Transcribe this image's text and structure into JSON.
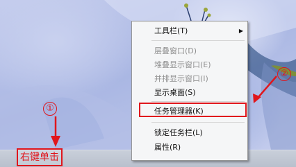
{
  "context_menu": {
    "items": [
      {
        "label": "工具栏(T)",
        "disabled": false,
        "submenu": true
      },
      {
        "label": "层叠窗口(D)",
        "disabled": true
      },
      {
        "label": "堆叠显示窗口(E)",
        "disabled": true
      },
      {
        "label": "并排显示窗口(I)",
        "disabled": true
      },
      {
        "label": "显示桌面(S)",
        "disabled": false
      },
      {
        "label": "任务管理器(K)",
        "disabled": false,
        "highlighted": true
      },
      {
        "label": "锁定任务栏(L)",
        "disabled": false
      },
      {
        "label": "属性(R)",
        "disabled": false
      }
    ],
    "submenu_arrow": "▶"
  },
  "taskbar": {
    "label": "右键单击"
  },
  "callouts": {
    "one": "①",
    "two": "②"
  },
  "colors": {
    "annotation": "#e0161c",
    "menu_bg": "#f5f6f7"
  }
}
